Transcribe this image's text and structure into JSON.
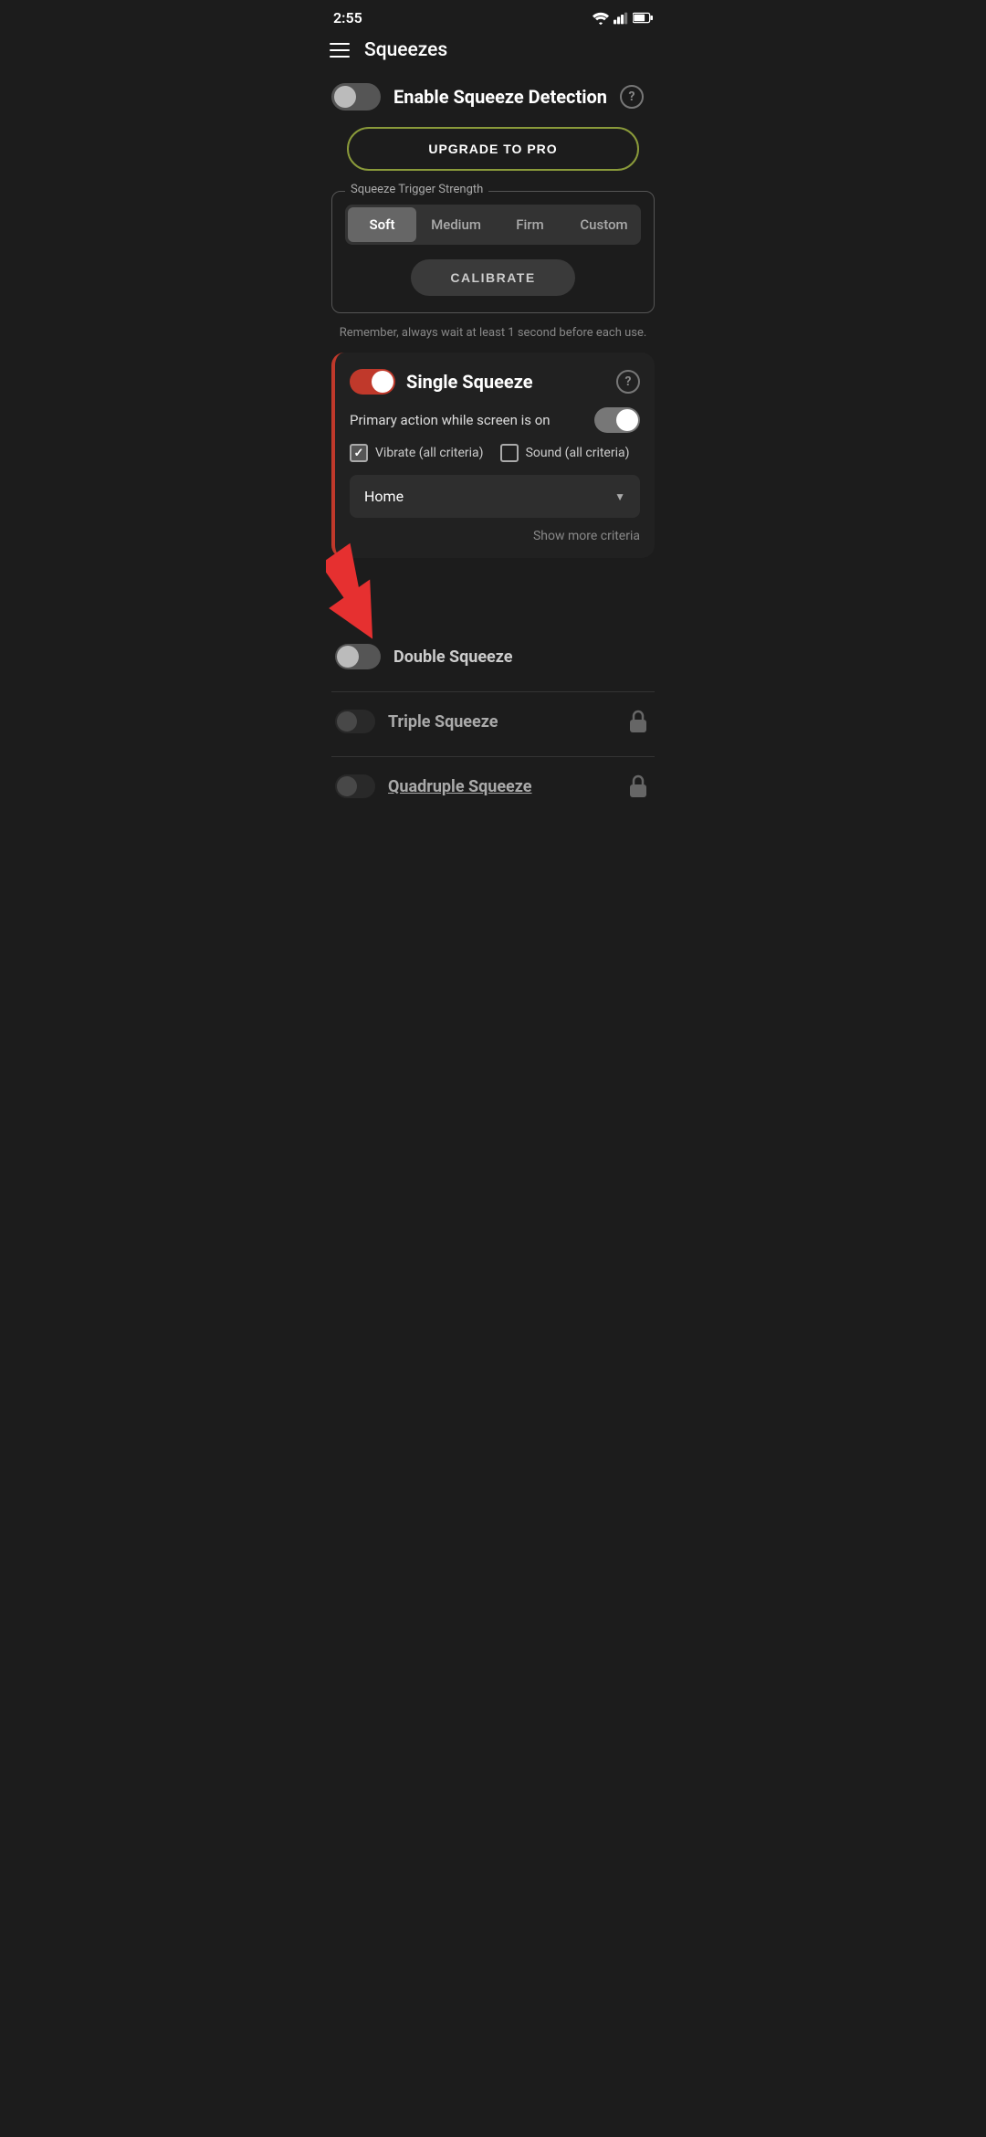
{
  "statusBar": {
    "time": "2:55"
  },
  "header": {
    "title": "Squeezes"
  },
  "enableDetection": {
    "label": "Enable Squeeze Detection",
    "enabled": false
  },
  "upgradePro": {
    "label": "UPGRADE TO PRO"
  },
  "triggerStrength": {
    "sectionLabel": "Squeeze Trigger Strength",
    "tabs": [
      "Soft",
      "Medium",
      "Firm",
      "Custom"
    ],
    "activeTab": 0,
    "calibrateLabel": "CALIBRATE"
  },
  "hint": {
    "text": "Remember, always wait at least 1 second before each use."
  },
  "singleSqueeze": {
    "title": "Single Squeeze",
    "enabled": true,
    "primaryActionLabel": "Primary action while screen is on",
    "primaryActionEnabled": true,
    "vibrate": {
      "label": "Vibrate (all criteria)",
      "checked": true
    },
    "sound": {
      "label": "Sound (all criteria)",
      "checked": false
    },
    "dropdown": {
      "value": "Home"
    },
    "showMoreLabel": "Show more criteria"
  },
  "doubleSqueeze": {
    "title": "Double Squeeze",
    "enabled": false
  },
  "tripleSqueeze": {
    "title": "Triple Squeeze",
    "enabled": false,
    "locked": true
  },
  "quadrupleSqueeze": {
    "title": "Quadruple Squeeze",
    "enabled": false,
    "locked": true
  },
  "icons": {
    "hamburger": "☰",
    "helpCircle": "?",
    "checkmark": "✓",
    "dropdownArrow": "▼",
    "lock": "🔒"
  }
}
